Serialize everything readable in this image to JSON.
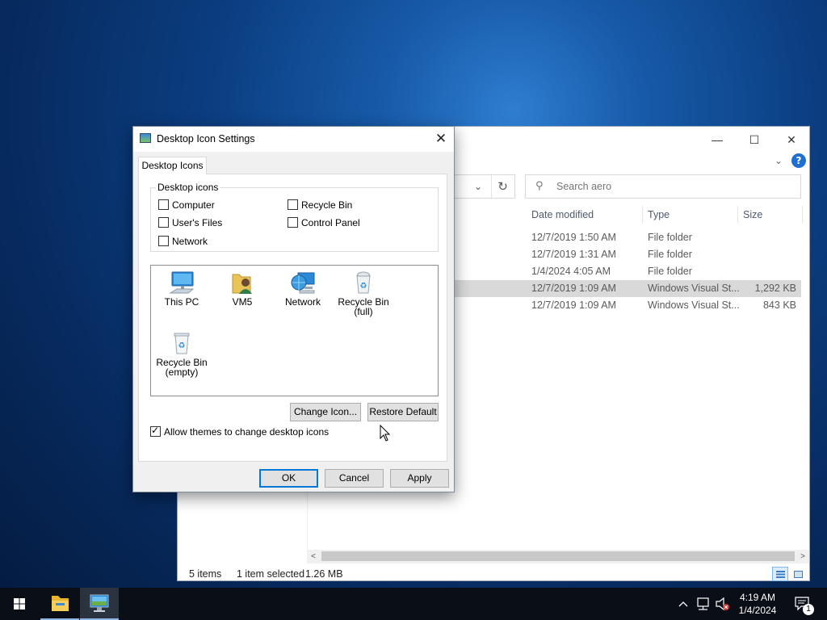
{
  "explorer": {
    "search_placeholder": "Search aero",
    "columns": [
      "Date modified",
      "Type",
      "Size"
    ],
    "rows": [
      {
        "date": "12/7/2019 1:50 AM",
        "type": "File folder",
        "size": ""
      },
      {
        "date": "12/7/2019 1:31 AM",
        "type": "File folder",
        "size": ""
      },
      {
        "date": "1/4/2024 4:05 AM",
        "type": "File folder",
        "size": ""
      },
      {
        "date": "12/7/2019 1:09 AM",
        "type": "Windows Visual St...",
        "size": "1,292 KB"
      },
      {
        "date": "12/7/2019 1:09 AM",
        "type": "Windows Visual St...",
        "size": "843 KB"
      }
    ],
    "status": {
      "items": "5 items",
      "selected": "1 item selected",
      "size": "1.26 MB"
    }
  },
  "dialog": {
    "title": "Desktop Icon Settings",
    "close_glyph": "✕",
    "tab": "Desktop Icons",
    "group_label": "Desktop icons",
    "checkboxes": [
      {
        "label": "Computer",
        "checked": false
      },
      {
        "label": "User's Files",
        "checked": false
      },
      {
        "label": "Network",
        "checked": false
      },
      {
        "label": "Recycle Bin",
        "checked": false
      },
      {
        "label": "Control Panel",
        "checked": false
      }
    ],
    "icons": [
      {
        "line1": "This PC",
        "line2": ""
      },
      {
        "line1": "VM5",
        "line2": ""
      },
      {
        "line1": "Network",
        "line2": ""
      },
      {
        "line1": "Recycle Bin",
        "line2": "(full)"
      },
      {
        "line1": "Recycle Bin",
        "line2": "(empty)"
      }
    ],
    "change_icon": "Change Icon...",
    "restore_default": "Restore Default",
    "allow_themes": {
      "label": "Allow themes to change desktop icons",
      "checked": true
    },
    "ok": "OK",
    "cancel": "Cancel",
    "apply": "Apply"
  },
  "taskbar": {
    "time": "4:19 AM",
    "date": "1/4/2024",
    "notification_count": "1"
  },
  "colors": {
    "accent": "#0078d7",
    "selected_row": "#d9d9d9",
    "taskbar": "#0a0f17"
  }
}
